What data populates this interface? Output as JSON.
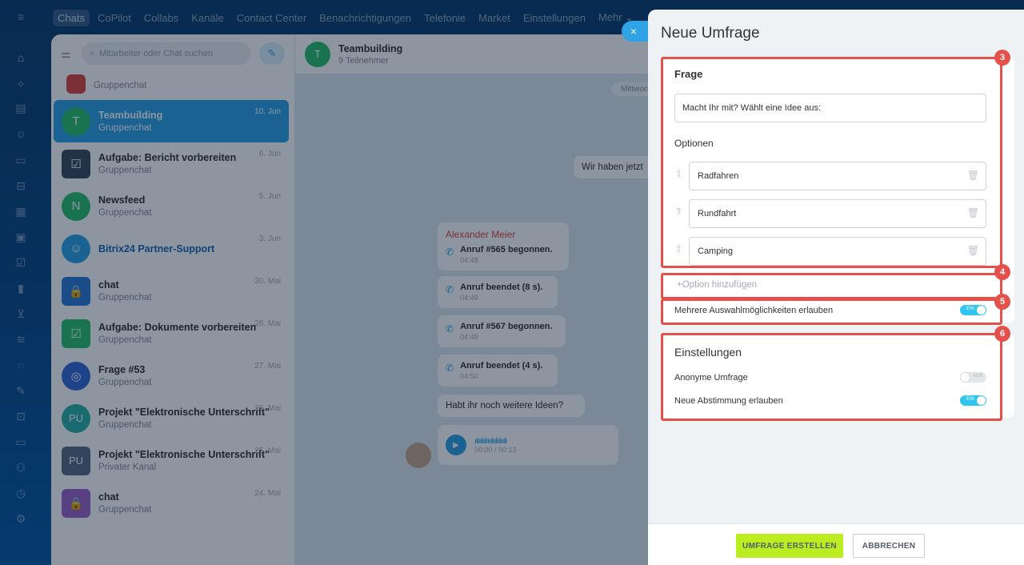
{
  "top_nav": {
    "tabs": [
      {
        "label": "Chats",
        "active": true
      },
      {
        "label": "CoPilot"
      },
      {
        "label": "Collabs"
      },
      {
        "label": "Kanäle"
      },
      {
        "label": "Contact Center"
      },
      {
        "label": "Benachrichtigungen"
      },
      {
        "label": "Telefonie"
      },
      {
        "label": "Market"
      },
      {
        "label": "Einstellungen"
      },
      {
        "label": "Mehr ⌄"
      }
    ]
  },
  "sidebar": {
    "icons": [
      "menu-icon",
      "home-icon",
      "copilot-icon",
      "feed-icon",
      "contacts-icon",
      "docs-icon",
      "crm-icon",
      "board-icon",
      "calendar-icon",
      "tasks-icon",
      "analytics-icon",
      "shop-icon",
      "filter-icon",
      "sites-icon",
      "sign-icon",
      "store-icon",
      "invoice-icon",
      "team-icon",
      "time-icon",
      "settings-icon"
    ]
  },
  "chat_list": {
    "search_placeholder": "Mitarbeiter oder Chat suchen",
    "items": [
      {
        "name": "",
        "sub": "Gruppenchat",
        "date": "",
        "avatar": "",
        "color": "#e0463f"
      },
      {
        "name": "Teambuilding",
        "sub": "Gruppenchat",
        "date": "10. Jun",
        "avatar": "T",
        "color": "#2fc26e",
        "active": true
      },
      {
        "name": "Aufgabe: Bericht vorbereiten",
        "sub": "Gruppenchat",
        "date": "6. Jun",
        "avatar": "☑",
        "color": "#3e4e5e"
      },
      {
        "name": "Newsfeed",
        "sub": "Gruppenchat",
        "date": "5. Jun",
        "avatar": "N",
        "color": "#2fc26e"
      },
      {
        "name": "Bitrix24 Partner-Support",
        "sub": "",
        "date": "3. Jun",
        "avatar": "☺",
        "color": "#2fa3e6"
      },
      {
        "name": "chat",
        "sub": "Gruppenchat",
        "date": "30. Mai",
        "avatar": "🔒",
        "color": "#2f7ad6"
      },
      {
        "name": "Aufgabe: Dokumente vorbereiten",
        "sub": "Gruppenchat",
        "date": "28. Mai",
        "avatar": "☑",
        "color": "#2fc26e"
      },
      {
        "name": "Frage #53",
        "sub": "Gruppenchat",
        "date": "27. Mai",
        "avatar": "◎",
        "color": "#3a6bd4"
      },
      {
        "name": "Projekt \"Elektronische Unterschrift\"",
        "sub": "Gruppenchat",
        "date": "26. Mai",
        "avatar": "PU",
        "color": "#2fb3a6"
      },
      {
        "name": "Projekt \"Elektronische Unterschrift\"",
        "sub": "Privater Kanal",
        "date": "25. Mai",
        "avatar": "PU",
        "color": "#5b6e86"
      },
      {
        "name": "chat",
        "sub": "Gruppenchat",
        "date": "24. Mai",
        "avatar": "🔒",
        "color": "#a065c9"
      }
    ]
  },
  "chat": {
    "title": "Teambuilding",
    "members": "9 Teilnehmer",
    "date_pill": "Mittwoch",
    "message_1": "Wir haben jetzt",
    "sender": "Alexander Meier",
    "calls": [
      {
        "text": "Anruf #565 begonnen.",
        "time": "04:48"
      },
      {
        "text": "Anruf beendet (8 s).",
        "time": "04:49"
      },
      {
        "text": "Anruf #567 begonnen.",
        "time": "04:49"
      },
      {
        "text": "Anruf beendet (4 s).",
        "time": "04:50"
      }
    ],
    "message_2": "Habt ihr noch weitere Ideen?",
    "audio_time": "00:00 / 00:13"
  },
  "form": {
    "title": "Neue Umfrage",
    "question_section": "Frage",
    "question_value": "Macht Ihr mit? Wählt eine Idee aus:",
    "options_label": "Optionen",
    "options": [
      "Radfahren",
      "Rundfahrt",
      "Camping"
    ],
    "add_option": "Option hinzufügen",
    "multi_choice_label": "Mehrere Auswahlmöglichkeiten erlauben",
    "multi_choice_on": true,
    "settings_title": "Einstellungen",
    "anonymous_label": "Anonyme Umfrage",
    "anonymous_on": false,
    "revote_label": "Neue Abstimmung erlauben",
    "revote_on": true,
    "toggle_on_text": "EIN",
    "toggle_off_text": "AUS",
    "badges": [
      "3",
      "4",
      "5",
      "6"
    ],
    "create_button": "UMFRAGE ERSTELLEN",
    "cancel_button": "ABBRECHEN",
    "close_symbol": "×",
    "highlight_color": "#e4514a",
    "create_color": "#bbed21"
  }
}
